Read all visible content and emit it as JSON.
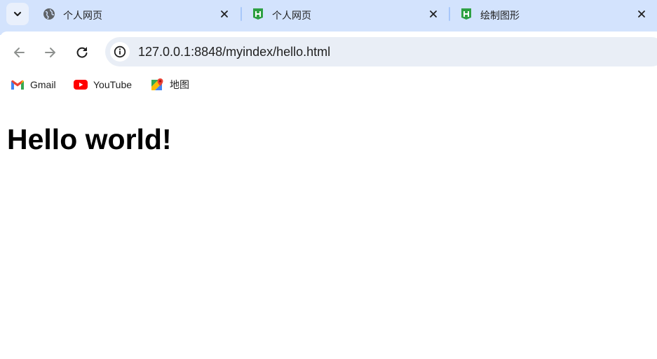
{
  "tabs": [
    {
      "title": "个人网页",
      "icon": "globe-icon",
      "active": false
    },
    {
      "title": "个人网页",
      "icon": "hbuilder-icon",
      "active": false
    },
    {
      "title": "绘制图形",
      "icon": "hbuilder-icon",
      "active": false
    }
  ],
  "toolbar": {
    "url": "127.0.0.1:8848/myindex/hello.html",
    "back_icon": "arrow-left-icon",
    "forward_icon": "arrow-right-icon",
    "reload_icon": "reload-icon",
    "site_info_icon": "info-icon"
  },
  "bookmarks": [
    {
      "label": "Gmail",
      "icon": "gmail-icon"
    },
    {
      "label": "YouTube",
      "icon": "youtube-icon"
    },
    {
      "label": "地图",
      "icon": "maps-icon"
    }
  ],
  "page": {
    "heading": "Hello world!"
  },
  "colors": {
    "tabstrip_bg": "#d3e3fd",
    "omnibox_bg": "#e9eef6",
    "hbuilder_green": "#2ea043",
    "youtube_red": "#ff0000"
  }
}
